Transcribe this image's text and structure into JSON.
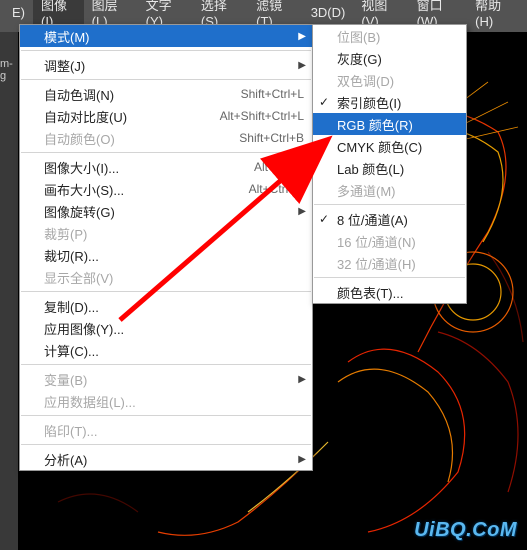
{
  "menubar": {
    "items": [
      {
        "label": "E)"
      },
      {
        "label": "图像(I)"
      },
      {
        "label": "图层(L)"
      },
      {
        "label": "文字(Y)"
      },
      {
        "label": "选择(S)"
      },
      {
        "label": "滤镜(T)"
      },
      {
        "label": "3D(D)"
      },
      {
        "label": "视图(V)"
      },
      {
        "label": "窗口(W)"
      },
      {
        "label": "帮助(H)"
      }
    ],
    "active_index": 1
  },
  "left_strip": "m-g",
  "dropdown": {
    "groups": [
      [
        {
          "label": "模式(M)",
          "arrow": true,
          "highlight": true
        }
      ],
      [
        {
          "label": "调整(J)",
          "arrow": true
        }
      ],
      [
        {
          "label": "自动色调(N)",
          "shortcut": "Shift+Ctrl+L"
        },
        {
          "label": "自动对比度(U)",
          "shortcut": "Alt+Shift+Ctrl+L"
        },
        {
          "label": "自动颜色(O)",
          "shortcut": "Shift+Ctrl+B",
          "disabled": true
        }
      ],
      [
        {
          "label": "图像大小(I)...",
          "shortcut": "Alt+Ctrl+I"
        },
        {
          "label": "画布大小(S)...",
          "shortcut": "Alt+Ctrl+C"
        },
        {
          "label": "图像旋转(G)",
          "arrow": true
        },
        {
          "label": "裁剪(P)",
          "disabled": true
        },
        {
          "label": "裁切(R)..."
        },
        {
          "label": "显示全部(V)",
          "disabled": true
        }
      ],
      [
        {
          "label": "复制(D)..."
        },
        {
          "label": "应用图像(Y)..."
        },
        {
          "label": "计算(C)..."
        }
      ],
      [
        {
          "label": "变量(B)",
          "arrow": true,
          "disabled": true
        },
        {
          "label": "应用数据组(L)...",
          "disabled": true
        }
      ],
      [
        {
          "label": "陷印(T)...",
          "disabled": true
        }
      ],
      [
        {
          "label": "分析(A)",
          "arrow": true
        }
      ]
    ]
  },
  "submenu": {
    "groups": [
      [
        {
          "label": "位图(B)",
          "disabled": true
        },
        {
          "label": "灰度(G)"
        },
        {
          "label": "双色调(D)",
          "disabled": true
        },
        {
          "label": "索引颜色(I)",
          "checked": true
        },
        {
          "label": "RGB 颜色(R)",
          "highlight": true
        },
        {
          "label": "CMYK 颜色(C)"
        },
        {
          "label": "Lab 颜色(L)"
        },
        {
          "label": "多通道(M)",
          "disabled": true
        }
      ],
      [
        {
          "label": "8 位/通道(A)",
          "checked": true
        },
        {
          "label": "16 位/通道(N)",
          "disabled": true
        },
        {
          "label": "32 位/通道(H)",
          "disabled": true
        }
      ],
      [
        {
          "label": "颜色表(T)..."
        }
      ]
    ]
  },
  "watermark": "UiBQ.CoM"
}
